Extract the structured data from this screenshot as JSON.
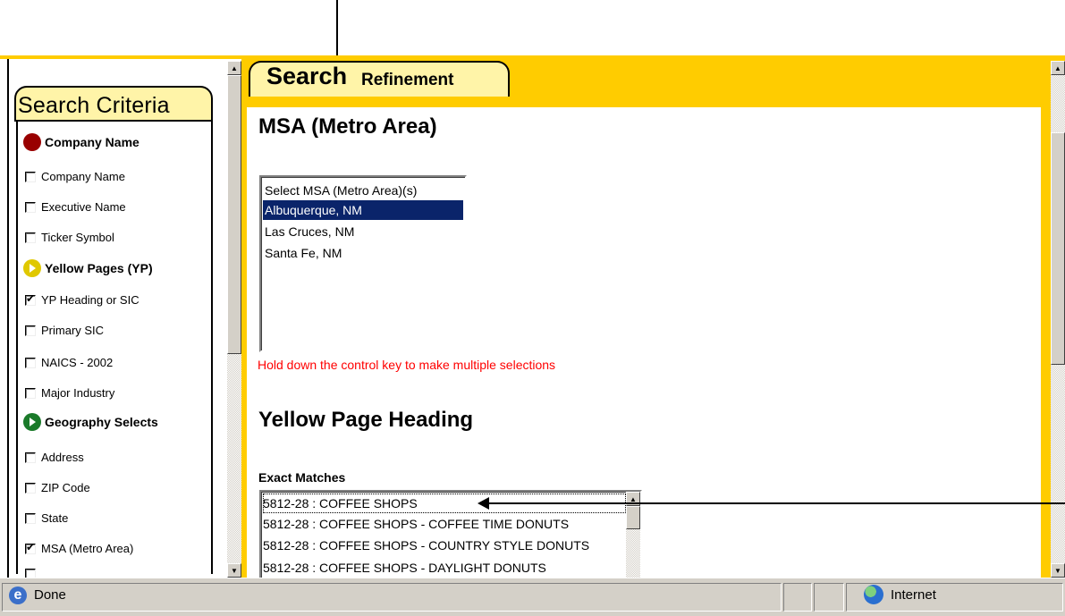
{
  "left_panel": {
    "tab_title": "Search Criteria",
    "groups": [
      {
        "title": "Company Name",
        "icon": "red-dot-icon",
        "items": [
          {
            "label": "Company Name",
            "checked": false
          },
          {
            "label": "Executive Name",
            "checked": false
          },
          {
            "label": "Ticker Symbol",
            "checked": false
          }
        ]
      },
      {
        "title": "Yellow Pages (YP)",
        "icon": "yellow-arrow-icon",
        "items": [
          {
            "label": "YP Heading or SIC",
            "checked": true
          },
          {
            "label": "Primary SIC",
            "checked": false
          },
          {
            "label": "NAICS - 2002",
            "checked": false
          },
          {
            "label": "Major Industry",
            "checked": false
          }
        ]
      },
      {
        "title": "Geography Selects",
        "icon": "green-arrow-icon",
        "items": [
          {
            "label": "Address",
            "checked": false
          },
          {
            "label": "ZIP Code",
            "checked": false
          },
          {
            "label": "State",
            "checked": false
          },
          {
            "label": "MSA (Metro Area)",
            "checked": true
          }
        ]
      }
    ]
  },
  "refinement": {
    "tab_word1": "Search",
    "tab_word2": "Refinement",
    "msa_heading": "MSA (Metro Area)",
    "msa_options": [
      {
        "label": "Select MSA (Metro Area)(s)",
        "selected": false
      },
      {
        "label": "Albuquerque, NM",
        "selected": true
      },
      {
        "label": "Las Cruces, NM",
        "selected": false
      },
      {
        "label": "Santa Fe, NM",
        "selected": false
      }
    ],
    "hint": "Hold down the control key to make multiple selections",
    "yp_heading": "Yellow Page Heading",
    "exact_label": "Exact Matches",
    "exact_matches": [
      "5812-28 : COFFEE SHOPS",
      "5812-28 : COFFEE SHOPS - COFFEE TIME DONUTS",
      "5812-28 : COFFEE SHOPS - COUNTRY STYLE DONUTS",
      "5812-28 : COFFEE SHOPS - DAYLIGHT DONUTS"
    ]
  },
  "statusbar": {
    "status": "Done",
    "zone": "Internet"
  }
}
